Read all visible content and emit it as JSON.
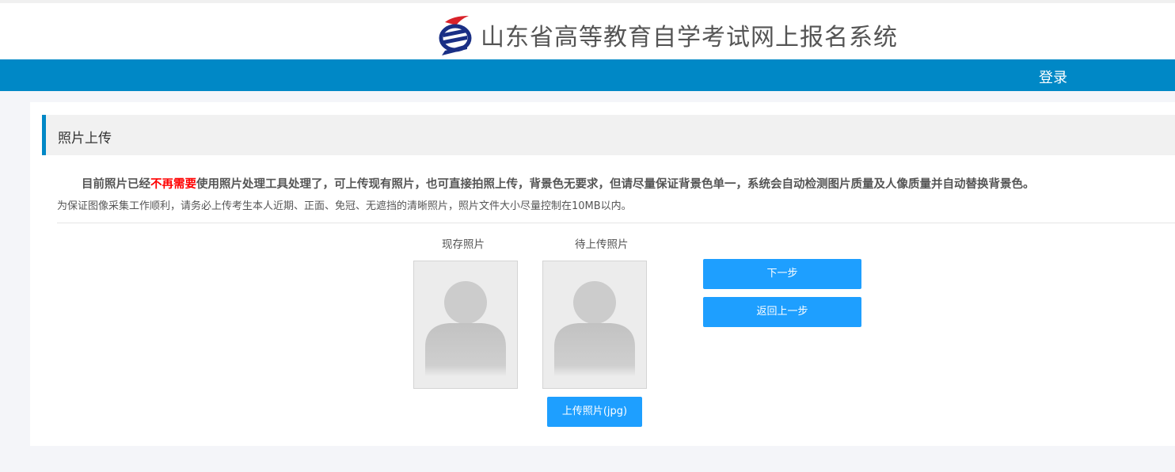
{
  "header": {
    "title": "山东省高等教育自学考试网上报名系统"
  },
  "nav": {
    "login": "登录"
  },
  "section": {
    "title": "照片上传"
  },
  "notice": {
    "line1_pre": "目前照片已经",
    "line1_highlight": "不再需要",
    "line1_post": "使用照片处理工具处理了，可上传现有照片，也可直接拍照上传，背景色无要求，但请尽量保证背景色单一，系统会自动检测图片质量及人像质量并自动替换背景色。",
    "line2": "为保证图像采集工作顺利，请务必上传考生本人近期、正面、免冠、无遮挡的清晰照片，照片文件大小尽量控制在10MB以内。"
  },
  "photos": {
    "current_label": "现存照片",
    "pending_label": "待上传照片",
    "upload_button": "上传照片(jpg)"
  },
  "actions": {
    "next": "下一步",
    "back": "返回上一步"
  },
  "colors": {
    "nav_blue": "#0088c6",
    "button_blue": "#1e9fff",
    "highlight_red": "#ff0000"
  }
}
